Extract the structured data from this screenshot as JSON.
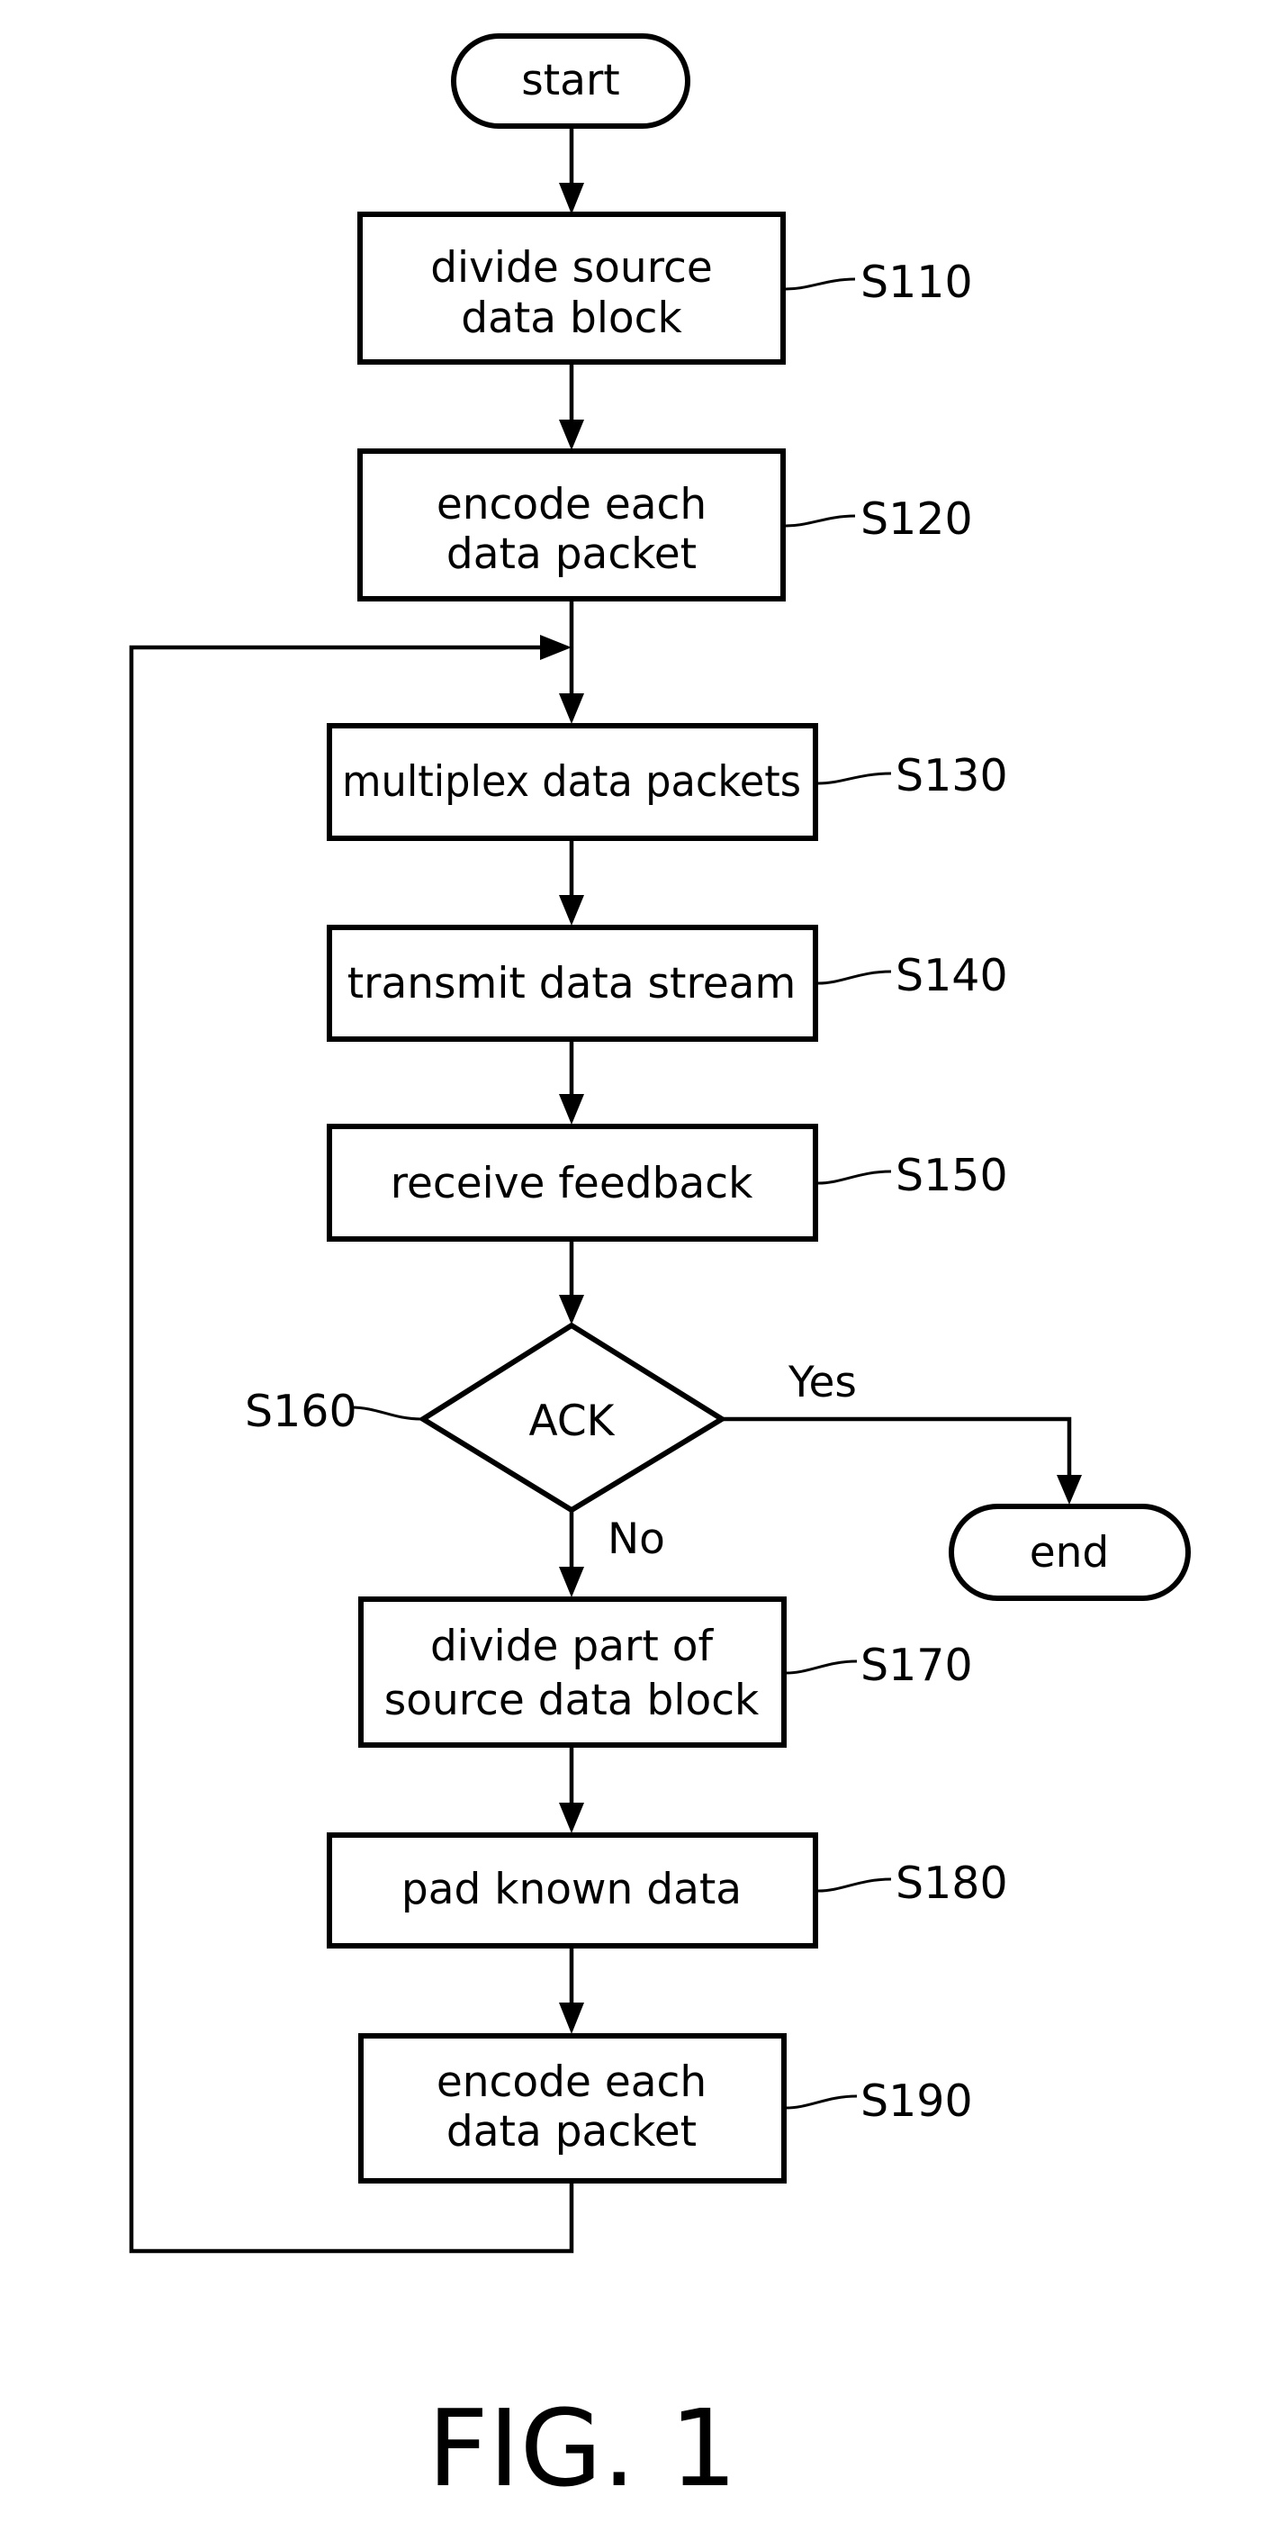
{
  "figure": {
    "caption": "FIG. 1",
    "terminals": {
      "start": {
        "label": "start"
      },
      "end": {
        "label": "end"
      }
    },
    "steps": [
      {
        "id": "S110",
        "lines": [
          "divide source",
          "data block"
        ]
      },
      {
        "id": "S120",
        "lines": [
          "encode each",
          "data packet"
        ]
      },
      {
        "id": "S130",
        "lines": [
          "multiplex data packets"
        ]
      },
      {
        "id": "S140",
        "lines": [
          "transmit data stream"
        ]
      },
      {
        "id": "S150",
        "lines": [
          "receive feedback"
        ]
      },
      {
        "id": "S170",
        "lines": [
          "divide part of",
          "source data block"
        ]
      },
      {
        "id": "S180",
        "lines": [
          "pad known data"
        ]
      },
      {
        "id": "S190",
        "lines": [
          "encode each",
          "data packet"
        ]
      }
    ],
    "decision": {
      "id": "S160",
      "label": "ACK",
      "yes_label": "Yes",
      "no_label": "No"
    },
    "colors": {
      "stroke": "#000000",
      "background": "#ffffff"
    }
  }
}
